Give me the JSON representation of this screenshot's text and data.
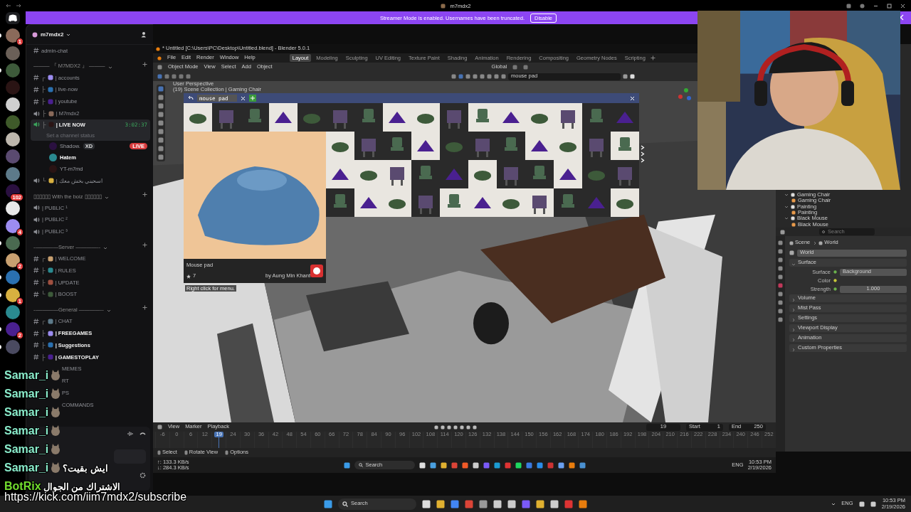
{
  "titlebar": {
    "title": "m7mdx2"
  },
  "banner": {
    "text": "Streamer Mode is enabled. Usernames have been truncated.",
    "button": "Disable"
  },
  "servers": [
    {
      "badge": "1",
      "unread": true
    },
    {
      "unread": false
    },
    {
      "unread": true
    },
    {
      "unread": false
    },
    {
      "unread": false
    },
    {
      "unread": false
    },
    {
      "unread": false
    },
    {
      "unread": false
    },
    {
      "unread": false
    },
    {
      "badge": "102",
      "unread": false
    },
    {
      "unread": false
    },
    {
      "badge": "4",
      "unread": false
    },
    {
      "unread": true
    },
    {
      "badge": "2",
      "unread": false
    },
    {
      "unread": true
    },
    {
      "badge": "1",
      "unread": true
    },
    {
      "unread": false
    },
    {
      "badge": "2",
      "unread": true
    },
    {
      "unread": true
    }
  ],
  "server_name": "m7mdx2",
  "channels": [
    {
      "kind": "text",
      "name": "admin-chat",
      "selected": false,
      "unread": false
    },
    {
      "kind": "category",
      "name": "——— 『 M7MDX2 』 ———"
    },
    {
      "kind": "text",
      "tree": "┌",
      "name": "| accounts",
      "selected": false,
      "unread": false
    },
    {
      "kind": "text",
      "tree": "├",
      "name": "| live-now",
      "selected": false,
      "unread": false
    },
    {
      "kind": "text",
      "tree": "├",
      "name": "| youtube",
      "selected": false,
      "unread": false
    },
    {
      "kind": "voice",
      "tree": "├",
      "name": "| M7mdx2",
      "selected": false,
      "unread": false
    },
    {
      "kind": "voice",
      "tree": "├",
      "name": "| LIVE NOW",
      "selected": true,
      "unread": false,
      "timer": "3:02:37",
      "status": "Set a channel status"
    },
    {
      "kind": "member",
      "name": "Shadow.",
      "tag": "XD",
      "live": true,
      "live_label": "LIVE"
    },
    {
      "kind": "member",
      "name": "Hatem"
    },
    {
      "kind": "member",
      "name": "YT-m7md"
    },
    {
      "kind": "voice",
      "tree": "└",
      "name": "| اسحبني بخش معك",
      "selected": false,
      "unread": false
    },
    {
      "kind": "category",
      "name": "▯▯▯▯▯▯ With the boiz ▯▯▯▯▯▯"
    },
    {
      "kind": "voice",
      "name": "| PUBLIC ¹",
      "selected": false,
      "unread": false
    },
    {
      "kind": "voice",
      "name": "| PUBLIC ²",
      "selected": false,
      "unread": false
    },
    {
      "kind": "voice",
      "name": "| PUBLIC ³",
      "selected": false,
      "unread": false
    },
    {
      "kind": "category",
      "name": "--————Server ————--"
    },
    {
      "kind": "text",
      "tree": "┌",
      "name": "| WELCOME",
      "selected": false,
      "unread": false
    },
    {
      "kind": "text",
      "tree": "├",
      "name": "| RULES",
      "selected": false,
      "unread": false
    },
    {
      "kind": "text",
      "tree": "├",
      "name": "| UPDATE",
      "selected": false,
      "unread": false
    },
    {
      "kind": "text",
      "tree": "└",
      "name": "| BOOST",
      "selected": false,
      "unread": false
    },
    {
      "kind": "category",
      "name": "--————General ————--"
    },
    {
      "kind": "text",
      "tree": "┌",
      "name": "| CHAT",
      "selected": false,
      "unread": false
    },
    {
      "kind": "text",
      "tree": "├",
      "name": "| FREEGAMES",
      "selected": false,
      "unread": true
    },
    {
      "kind": "text",
      "tree": "├",
      "name": "| Suggestions",
      "selected": false,
      "unread": true
    },
    {
      "kind": "text",
      "tree": "├",
      "name": "| GAMESTOPLAY",
      "selected": false,
      "unread": true
    },
    {
      "kind": "partial",
      "name": "MEMES"
    },
    {
      "kind": "partial",
      "name": "RT"
    },
    {
      "kind": "partial",
      "name": "PS"
    },
    {
      "kind": "partial",
      "name": "COMMANDS"
    }
  ],
  "chat": [
    {
      "user": "Samar_i",
      "color": "#8aeccb",
      "emote": true
    },
    {
      "user": "Samar_i",
      "color": "#8aeccb",
      "emote": true
    },
    {
      "user": "Samar_i",
      "color": "#8aeccb",
      "emote": true
    },
    {
      "user": "Samar_i",
      "color": "#8aeccb",
      "emote": true
    },
    {
      "user": "Samar_i",
      "color": "#8aeccb",
      "emote": true
    },
    {
      "user": "Samar_i",
      "color": "#8aeccb",
      "emote": true,
      "text": "ايش بقيت؟"
    },
    {
      "user": "BotRix",
      "color": "#72dc2e",
      "emote": false,
      "text": "الاشتراك من الجوال"
    }
  ],
  "subscribe_url": "https://kick.com/iim7mdx2/subscribe",
  "blender": {
    "title": "* Untitled [C:\\Users\\PC\\Desktop\\Untitled.blend] - Blender 5.0.1",
    "menu": [
      "File",
      "Edit",
      "Render",
      "Window",
      "Help"
    ],
    "workspaces": [
      {
        "label": "Layout",
        "selected": true
      },
      {
        "label": "Modeling",
        "selected": false
      },
      {
        "label": "Sculpting",
        "selected": false
      },
      {
        "label": "UV Editing",
        "selected": false
      },
      {
        "label": "Texture Paint",
        "selected": false
      },
      {
        "label": "Shading",
        "selected": false
      },
      {
        "label": "Animation",
        "selected": false
      },
      {
        "label": "Rendering",
        "selected": false
      },
      {
        "label": "Compositing",
        "selected": false
      },
      {
        "label": "Geometry Nodes",
        "selected": false
      },
      {
        "label": "Scripting",
        "selected": false
      }
    ],
    "mode": "Object Mode",
    "header_menu": [
      "View",
      "Select",
      "Add",
      "Object"
    ],
    "orientation": "Global",
    "search": "mouse pad",
    "viewport": {
      "kind": "picture",
      "perspective": "User Perspective",
      "collection": "(19) Scene Collection | Gaming Chair",
      "hint": "Right click for menu."
    },
    "asset_browser": {
      "search": "mouse pad",
      "preview": {
        "kind": "picture",
        "name": "Mouse pad",
        "rating": "7",
        "author": "by Aung Min Khant"
      }
    },
    "timeline": {
      "menu": [
        "View",
        "Marker",
        "Playback"
      ],
      "frame": "19",
      "start_label": "Start",
      "start": "1",
      "end_label": "End",
      "end": "250",
      "ticks": [
        {
          "label": "-6",
          "selected": false
        },
        {
          "label": "0",
          "selected": false
        },
        {
          "label": "6",
          "selected": false
        },
        {
          "label": "12",
          "selected": false
        },
        {
          "label": "19",
          "selected": true
        },
        {
          "label": "24",
          "selected": false
        },
        {
          "label": "30",
          "selected": false
        },
        {
          "label": "36",
          "selected": false
        },
        {
          "label": "42",
          "selected": false
        },
        {
          "label": "48",
          "selected": false
        },
        {
          "label": "54",
          "selected": false
        },
        {
          "label": "60",
          "selected": false
        },
        {
          "label": "66",
          "selected": false
        },
        {
          "label": "72",
          "selected": false
        },
        {
          "label": "78",
          "selected": false
        },
        {
          "label": "84",
          "selected": false
        },
        {
          "label": "90",
          "selected": false
        },
        {
          "label": "96",
          "selected": false
        },
        {
          "label": "102",
          "selected": false
        },
        {
          "label": "108",
          "selected": false
        },
        {
          "label": "114",
          "selected": false
        },
        {
          "label": "120",
          "selected": false
        },
        {
          "label": "126",
          "selected": false
        },
        {
          "label": "132",
          "selected": false
        },
        {
          "label": "138",
          "selected": false
        },
        {
          "label": "144",
          "selected": false
        },
        {
          "label": "150",
          "selected": false
        },
        {
          "label": "156",
          "selected": false
        },
        {
          "label": "162",
          "selected": false
        },
        {
          "label": "168",
          "selected": false
        },
        {
          "label": "174",
          "selected": false
        },
        {
          "label": "180",
          "selected": false
        },
        {
          "label": "186",
          "selected": false
        },
        {
          "label": "192",
          "selected": false
        },
        {
          "label": "198",
          "selected": false
        },
        {
          "label": "204",
          "selected": false
        },
        {
          "label": "210",
          "selected": false
        },
        {
          "label": "216",
          "selected": false
        },
        {
          "label": "222",
          "selected": false
        },
        {
          "label": "228",
          "selected": false
        },
        {
          "label": "234",
          "selected": false
        },
        {
          "label": "240",
          "selected": false
        },
        {
          "label": "246",
          "selected": false
        },
        {
          "label": "252",
          "selected": false
        }
      ]
    },
    "status": [
      "Select",
      "Rotate View",
      "Options"
    ],
    "net": [
      "↑: 133.3 KB/s",
      "↓: 284.3 KB/s"
    ],
    "taskbar": {
      "search": "Search",
      "lang": "ENG",
      "time": "10:53 PM",
      "date": "2/19/2026"
    }
  },
  "properties": {
    "outliner": [
      {
        "name": "Gaming Chair",
        "children": [
          {
            "name": "Gaming Chair"
          }
        ]
      },
      {
        "name": "Painting",
        "children": [
          {
            "name": "Painting"
          }
        ]
      },
      {
        "name": "Black Mouse",
        "children": [
          {
            "name": "Black Mouse"
          }
        ]
      }
    ],
    "search": "Search",
    "breadcrumb": [
      "Scene",
      "World"
    ],
    "datablock": "World",
    "rows": [
      {
        "label": "Surface",
        "value": "Background"
      },
      {
        "label": "Color"
      },
      {
        "label": "Strength",
        "value": "1.000"
      }
    ],
    "panels": [
      {
        "label": "Surface",
        "expanded": true
      },
      {
        "label": "Volume",
        "expanded": false
      },
      {
        "label": "Mist Pass",
        "expanded": false
      },
      {
        "label": "Settings",
        "expanded": false
      },
      {
        "label": "Viewport Display",
        "expanded": false
      },
      {
        "label": "Animation",
        "expanded": false
      },
      {
        "label": "Custom Properties",
        "expanded": false
      }
    ]
  },
  "taskbar": {
    "search": "Search",
    "lang": "ENG",
    "time": "10:53 PM",
    "date": "2/19/2026"
  }
}
